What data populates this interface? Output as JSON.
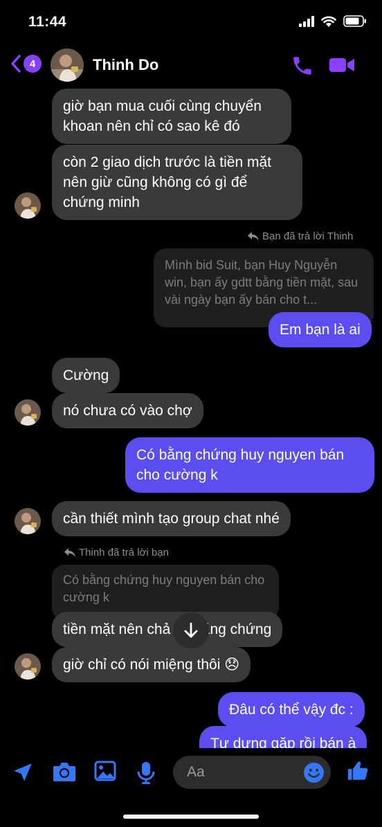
{
  "status": {
    "time": "11:44"
  },
  "header": {
    "back_count": "4",
    "contact_name": "Thinh Do"
  },
  "messages": {
    "m1": "giờ bạn mua cuối cùng chuyển khoan nên chỉ có sao kê đó",
    "m2": "còn 2 giao dịch trước là tiền mặt nên giừ cũng không có gì để chứng minh",
    "reply1_note": "Bạn đã trả lời Thinh",
    "reply1_quote": "Mình bid Suit, bạn Huy Nguyễn win, bạn ấy gdtt bằng tiền mặt, sau vài ngày bạn ấy bán cho t...",
    "m3": "Em bạn là ai",
    "m4": "Cường",
    "m5": "nó chưa có vào chợ",
    "m6": "Có bằng chứng huy nguyen bán cho cường k",
    "m7": "cần thiết mình tạo group chat nhé",
    "reply2_note": "Thinh đã trả lời bạn",
    "reply2_quote": "Có bằng chứng huy nguyen bán cho cường k",
    "m8": "tiền mặt nên chả có bằng chứng",
    "m9": "giờ chỉ có nói miệng thôi 😞",
    "m10": "Đâu có thể vậy đc :",
    "m11": "Tự dưng gặp rồi bán à"
  },
  "composer": {
    "placeholder": "Aa"
  },
  "colors": {
    "accent": "#8a3ffc",
    "outgoing": "#5b4df0",
    "incoming": "#3a3a3c",
    "icon_blue": "#3478f6"
  }
}
